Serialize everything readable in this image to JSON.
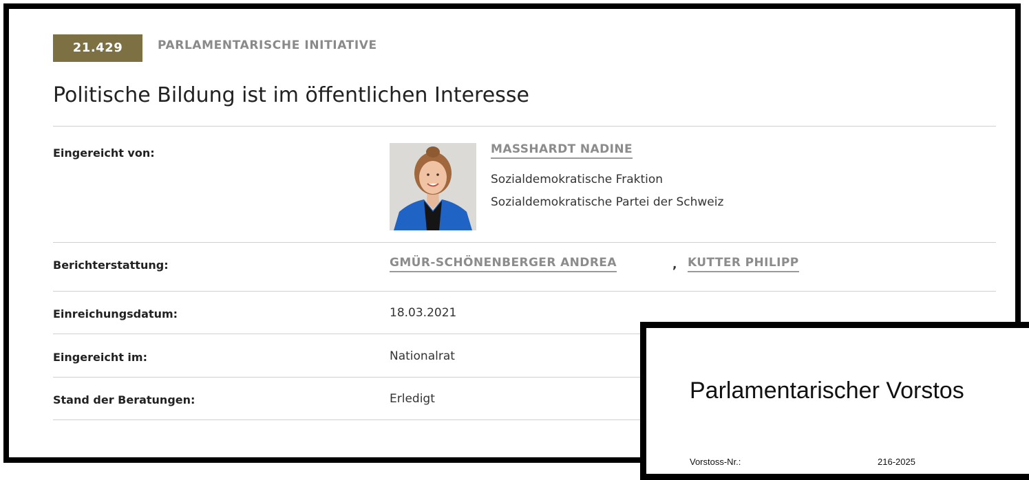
{
  "business": {
    "number": "21.429",
    "type": "PARLAMENTARISCHE INITIATIVE",
    "title": "Politische Bildung ist im öffentlichen Interesse"
  },
  "fields": {
    "submitted_by_label": "Eingereicht von:",
    "author_name": "MASSHARDT NADINE",
    "author_group": "Sozialdemokratische Fraktion",
    "author_party": "Sozialdemokratische Partei der Schweiz",
    "reporting_label": "Berichterstattung:",
    "reporters": [
      "GMÜR-SCHÖNENBERGER ANDREA",
      "KUTTER PHILIPP"
    ],
    "reporter_separator": ",",
    "date_label": "Einreichungsdatum:",
    "date_value": "18.03.2021",
    "council_label": "Eingereicht im:",
    "council_value": "Nationalrat",
    "status_label": "Stand der Beratungen:",
    "status_value": "Erledigt"
  },
  "document": {
    "title": "Parlamentarischer Vorstos",
    "field_label": "Vorstoss-Nr.:",
    "field_value": "216-2025"
  },
  "colors": {
    "badge": "#7d7043",
    "link": "#8c8c8c",
    "divider": "#cfcfcf"
  }
}
